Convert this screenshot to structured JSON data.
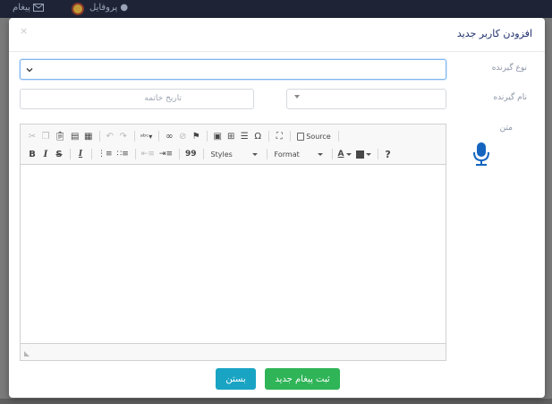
{
  "background": {
    "nav_items": [
      {
        "label": "پیغام",
        "icon": "envelope-icon"
      },
      {
        "label": "پروفایل",
        "icon": "user-icon"
      }
    ]
  },
  "modal": {
    "title": "افزودن کاربر جدید",
    "close": "×"
  },
  "form": {
    "receiver_type_label": "نوع گیرنده",
    "receiver_type_value": "",
    "receiver_name_label": "نام گیرنده",
    "receiver_name_value": "",
    "expiry_date_placeholder": "تاریخ خاتمه",
    "expiry_date_value": "",
    "text_label": "متن"
  },
  "editor": {
    "toolbar_row1": [
      "cut-icon",
      "copy-icon",
      "paste-icon",
      "paste-text-icon",
      "paste-word-icon",
      "undo-icon",
      "redo-icon",
      "spellcheck-icon",
      "link-icon",
      "unlink-icon",
      "anchor-icon",
      "image-icon",
      "table-icon",
      "horizontal-rule-icon",
      "special-char-icon",
      "maximize-icon",
      "source-icon"
    ],
    "source_label": "Source",
    "styles_label": "Styles",
    "format_label": "Format",
    "help_label": "?",
    "bold_label": "B",
    "italic_label": "I",
    "strike_label": "S",
    "remove_format_label": "Ix",
    "text_color_label": "A",
    "quote_label": "99"
  },
  "buttons": {
    "submit": "ثبت پیغام جدید",
    "close": "بستن"
  },
  "colors": {
    "primary": "#2fb457",
    "info": "#1aa4c4",
    "title": "#1d2d6b",
    "mic": "#1565c0"
  }
}
